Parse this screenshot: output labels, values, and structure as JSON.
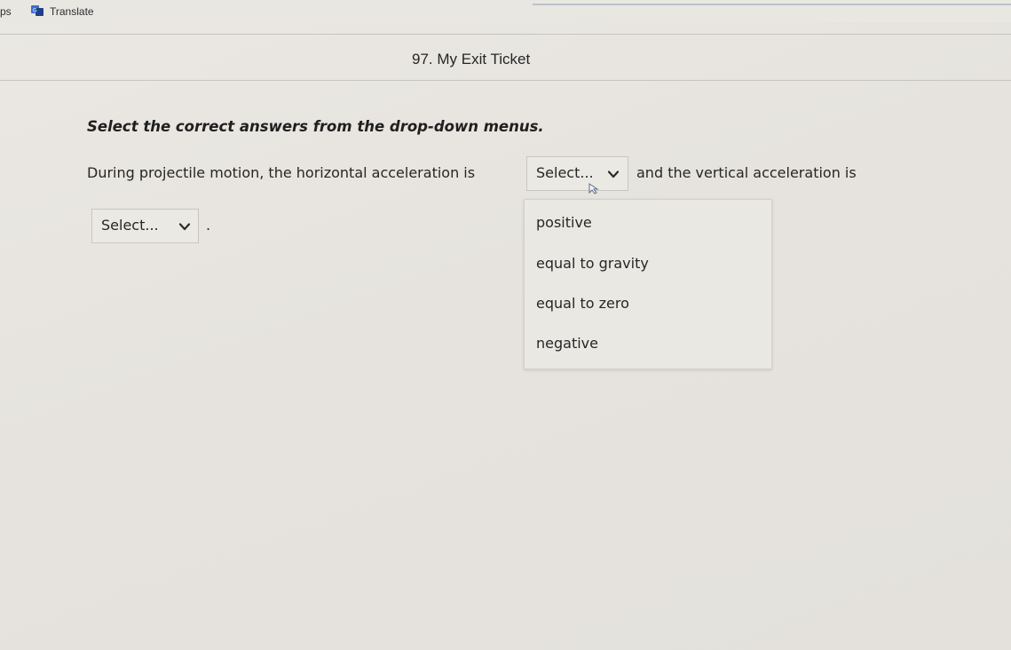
{
  "topbar": {
    "left_label": "ps",
    "translate_label": "Translate",
    "translate_icon": "translate-icon"
  },
  "page": {
    "title": "97. My Exit Ticket"
  },
  "question": {
    "instructions": "Select the correct answers from the drop-down menus.",
    "sentence_part1": "During projectile motion, the horizontal acceleration is",
    "sentence_part2": "and the vertical acceleration is",
    "sentence_end": "."
  },
  "dropdowns": {
    "first": {
      "selected": "Select...",
      "icon": "chevron-down-icon",
      "expanded": true,
      "options": [
        "positive",
        "equal to gravity",
        "equal to zero",
        "negative"
      ]
    },
    "second": {
      "selected": "Select...",
      "icon": "chevron-down-icon",
      "expanded": false
    }
  },
  "colors": {
    "background": "#e8e5e0",
    "text": "#262626",
    "border": "#c9c6c1"
  }
}
